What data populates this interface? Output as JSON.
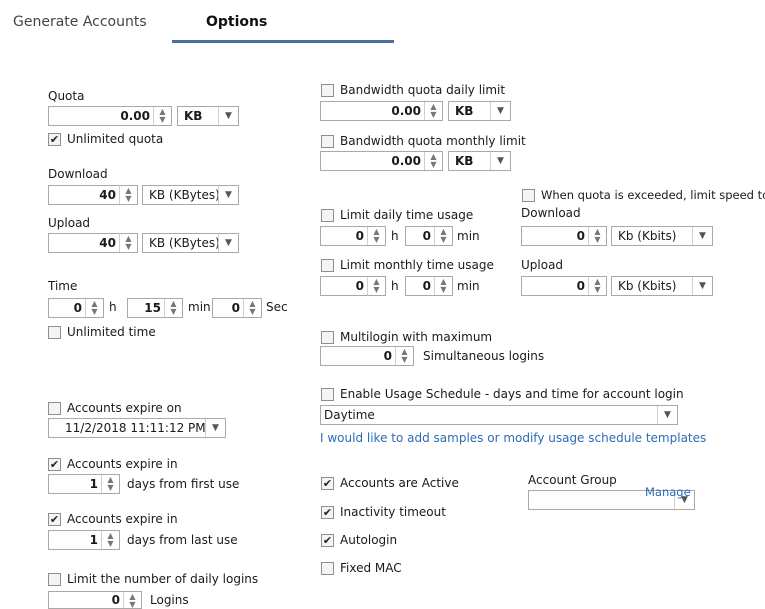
{
  "tabs": {
    "generate": "Generate  Accounts",
    "options": "Options"
  },
  "quota": {
    "label": "Quota",
    "value": "0.00",
    "unit": "KB",
    "unlimited_label": "Unlimited quota",
    "unlimited_checked": true
  },
  "download": {
    "label": "Download",
    "value": "40",
    "unit": "KB (KBytes)"
  },
  "upload": {
    "label": "Upload",
    "value": "40",
    "unit": "KB (KBytes)"
  },
  "time": {
    "label": "Time",
    "hours": "0",
    "h": "h",
    "minutes": "15",
    "min": "min",
    "seconds": "0",
    "sec": "Sec",
    "unlimited_label": "Unlimited time",
    "unlimited_checked": false
  },
  "bw_daily": {
    "label": "Bandwidth quota daily limit",
    "value": "0.00",
    "unit": "KB",
    "checked": false
  },
  "bw_monthly": {
    "label": "Bandwidth quota monthly limit",
    "value": "0.00",
    "unit": "KB",
    "checked": false
  },
  "limit_speed": {
    "label": "When quota is exceeded, limit speed to",
    "checked": false,
    "download_label": "Download",
    "download_value": "0",
    "download_unit": "Kb (Kbits)",
    "upload_label": "Upload",
    "upload_value": "0",
    "upload_unit": "Kb (Kbits)"
  },
  "daily_time": {
    "label": "Limit daily time usage",
    "hours": "0",
    "h": "h",
    "minutes": "0",
    "min": "min",
    "checked": false
  },
  "monthly_time": {
    "label": "Limit monthly time usage",
    "hours": "0",
    "h": "h",
    "minutes": "0",
    "min": "min",
    "checked": false
  },
  "multilogin": {
    "label": "Multilogin with maximum",
    "value": "0",
    "suffix": "Simultaneous logins",
    "checked": false
  },
  "schedule": {
    "label": "Enable Usage Schedule - days and time for account login",
    "checked": false,
    "selected": "Daytime",
    "link": "I would like to add samples or modify usage schedule templates"
  },
  "expire_on": {
    "label": "Accounts expire on",
    "checked": false,
    "value": "11/2/2018 11:11:12 PM"
  },
  "expire_first": {
    "label": "Accounts expire in",
    "checked": true,
    "value": "1",
    "suffix": "days from first use"
  },
  "expire_last": {
    "label": "Accounts expire in",
    "checked": true,
    "value": "1",
    "suffix": "days from last use"
  },
  "daily_logins": {
    "label": "Limit the number of daily logins",
    "checked": false,
    "value": "0",
    "suffix": "Logins"
  },
  "flags": {
    "active": {
      "label": "Accounts are Active",
      "checked": true
    },
    "inactivity": {
      "label": "Inactivity timeout",
      "checked": true
    },
    "autologin": {
      "label": "Autologin",
      "checked": true
    },
    "fixed_mac": {
      "label": "Fixed MAC",
      "checked": false
    }
  },
  "account_group": {
    "label": "Account Group",
    "manage": "Manage",
    "value": ""
  },
  "glyphs": {
    "check": "✔",
    "spin": "▲▼",
    "dropdown": "▼"
  }
}
